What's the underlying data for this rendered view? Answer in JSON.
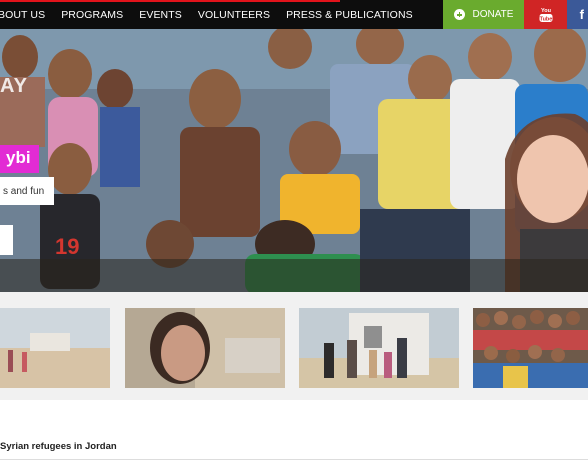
{
  "nav": {
    "items": [
      {
        "label": "BOUT US"
      },
      {
        "label": "PROGRAMS"
      },
      {
        "label": "EVENTS"
      },
      {
        "label": "VOLUNTEERS"
      },
      {
        "label": "PRESS & PUBLICATIONS"
      }
    ],
    "donate_label": "DONATE",
    "donate_icon": "plus-circle-icon",
    "youtube_label": "You Tube",
    "facebook_label": "f",
    "colors": {
      "bar": "#0d0d0d",
      "accent_line": "#e2131b",
      "donate": "#6aab2e",
      "youtube": "#d02525",
      "facebook": "#3b5998"
    }
  },
  "hero": {
    "title_fragment": "AY",
    "badge_text": "ybi",
    "subtitle_fragment": "s and fun",
    "badge_color": "#e22bd4"
  },
  "thumbnails": [
    {
      "icon": "desert-camp-photo"
    },
    {
      "icon": "girl-portrait-photo"
    },
    {
      "icon": "refugee-family-photo"
    },
    {
      "icon": "crowd-photo"
    }
  ],
  "footer": {
    "caption": "Syrian refugees in Jordan"
  }
}
